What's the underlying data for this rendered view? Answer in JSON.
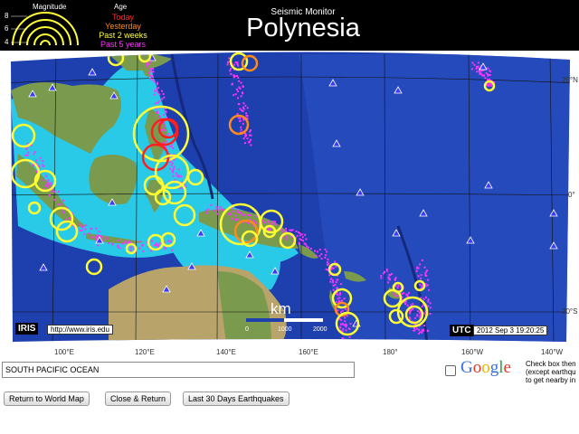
{
  "header": {
    "legend_magnitude_title": "Magnitude",
    "legend_age_title": "Age",
    "magnitude_ticks": [
      "8",
      "6",
      "4"
    ],
    "age_rows": [
      {
        "label": "Today",
        "color": "#ff2a2a"
      },
      {
        "label": "Yesterday",
        "color": "#ff8c1a"
      },
      {
        "label": "Past 2 weeks",
        "color": "#ffff33"
      },
      {
        "label": "Past 5 years",
        "color": "#ff33ff"
      }
    ],
    "subtitle": "Seismic Monitor",
    "title": "Polynesia"
  },
  "map": {
    "iris_badge": "IRIS",
    "iris_url": "http://www.iris.edu",
    "scale_label": "km",
    "scale_ticks": [
      "0",
      "1000",
      "2000"
    ],
    "utc_badge": "UTC",
    "timestamp": "2012 Sep  3 19:20:25",
    "lat_labels": [
      "20°N",
      "0°",
      "20°S"
    ],
    "lon_labels": [
      "100°E",
      "120°E",
      "140°E",
      "160°E",
      "180°",
      "160°W",
      "140°W"
    ],
    "colors": {
      "deep_ocean": "#1e3fae",
      "shallow_ocean": "#29c9e8",
      "land": "#7a9a4e",
      "today": "#ff1f1f",
      "yesterday": "#ff8a1a",
      "past_2_weeks": "#ffff33",
      "past_5_years": "#ff33ff",
      "volcano": "#3a3aff"
    },
    "icons": [
      "volcano-triangle-icon",
      "earthquake-circle-icon"
    ]
  },
  "region": {
    "value": "SOUTH PACIFIC OCEAN"
  },
  "google": {
    "logo_text": "Google",
    "note_lines": [
      "Check box then",
      "(except earthqu",
      "to get nearby in"
    ]
  },
  "buttons": {
    "world_map": "Return to World Map",
    "close_return": "Close & Return",
    "last_30_days": "Last 30 Days Earthquakes"
  }
}
